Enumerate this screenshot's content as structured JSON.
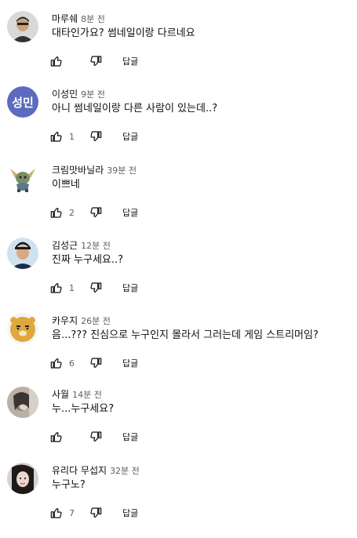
{
  "comments": [
    {
      "author": "마루쉐",
      "time": "8분 전",
      "text": "대타인가요? 썸네일이랑 다르네요",
      "likes": "",
      "reply": "답글",
      "avatar": "photo-avatar"
    },
    {
      "author": "이성민",
      "time": "9분 전",
      "text": "아니 썸네일이랑 다른 사람이 있는데..?",
      "likes": "1",
      "reply": "답글",
      "avatar_initials": "성민",
      "avatar_color": "#5c6bc0"
    },
    {
      "author": "크림맛바닐라",
      "time": "39분 전",
      "text": "이쁘네",
      "likes": "2",
      "reply": "답글",
      "avatar": "character-avatar"
    },
    {
      "author": "김성근",
      "time": "12분 전",
      "text": "진짜 누구세요..?",
      "likes": "1",
      "reply": "답글",
      "avatar": "photo-avatar"
    },
    {
      "author": "카우지",
      "time": "26분 전",
      "text": "음...??? 진심으로 누구인지 몰라서 그러는데 게임 스트리머임?",
      "likes": "6",
      "reply": "답글",
      "avatar": "cartoon-avatar"
    },
    {
      "author": "사월",
      "time": "14분 전",
      "text": "누...누구세요?",
      "likes": "",
      "reply": "답글",
      "avatar": "photo-avatar"
    },
    {
      "author": "유리다 무섭지",
      "time": "32분 전",
      "text": "누구노?",
      "likes": "7",
      "reply": "답글",
      "avatar": "photo-avatar"
    }
  ],
  "icons": {
    "like": "thumb-up-icon",
    "dislike": "thumb-down-icon"
  },
  "colors": {
    "text": "#0f0f0f",
    "secondary": "#606060",
    "background": "#ffffff"
  }
}
